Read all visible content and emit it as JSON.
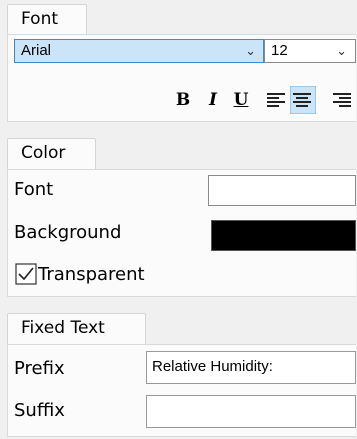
{
  "font_section": {
    "tab": "Font",
    "family_value": "Arial",
    "size_value": "12",
    "bold_label": "B",
    "italic_label": "I",
    "underline_label": "U"
  },
  "color_section": {
    "tab": "Color",
    "font_label": "Font",
    "background_label": "Background",
    "transparent_label": "Transparent",
    "transparent_checked": true,
    "font_color": "#ffffff",
    "background_color": "#000000"
  },
  "fixed_text_section": {
    "tab": "Fixed Text",
    "prefix_label": "Prefix",
    "prefix_value": "Relative Humidity:",
    "suffix_label": "Suffix",
    "suffix_value": ""
  }
}
